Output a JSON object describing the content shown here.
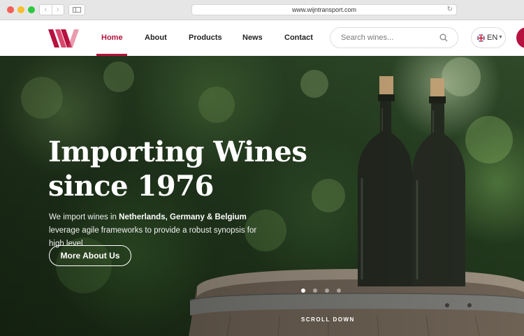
{
  "browser": {
    "url": "www.wijntransport.com",
    "back_icon": "‹",
    "forward_icon": "›",
    "reload_icon": "↻"
  },
  "header": {
    "nav": [
      {
        "label": "Home",
        "active": true
      },
      {
        "label": "About"
      },
      {
        "label": "Products",
        "has_dropdown": true
      },
      {
        "label": "News"
      },
      {
        "label": "Contact"
      }
    ],
    "search": {
      "placeholder": "Search wines..."
    },
    "language": {
      "label": "EN",
      "flag": "uk-flag-icon"
    }
  },
  "hero": {
    "title_line1": "Importing Wines",
    "title_line2": "since 1976",
    "subtitle_pre": "We import wines in ",
    "subtitle_bold": "Netherlands, Germany & Belgium",
    "subtitle_post": " leverage agile frameworks to provide a robust synopsis for high level",
    "cta_label": "More About Us",
    "slider_dots": 4,
    "active_dot": 0,
    "scroll_label": "SCROLL DOWN"
  },
  "colors": {
    "accent": "#b5123f",
    "text_dark": "#222222",
    "hero_text": "#ffffff"
  }
}
